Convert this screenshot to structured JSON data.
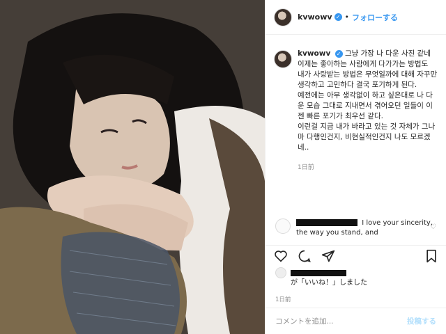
{
  "post": {
    "username": "kvwowv",
    "follow_label": "フォローする",
    "dot": "•",
    "verified_icon": "verified-badge-icon"
  },
  "caption": {
    "username": "kvwowv",
    "lines": [
      "그냥 가장 나 다운 사진 같네",
      "이제는 좋아하는 사람에게 다가가는 방법도",
      "내가 사랑받는 방법은 무엇일까에 대해 자꾸만 생각하고 고민하다 결국 포기하게 된다.",
      "예전에는 아무 생각없이 하고 싶은대로 나 다운 모습 그대로 지내면서 겪어오던 일들이 이젠 빠른 포기가 최우선 같다.",
      "이런걸 지금 내가 바라고 있는 것 자체가 그나마 다행인건지, 비현실적인건지 나도 모르겠네.."
    ],
    "time": "1日前"
  },
  "comment": {
    "text": "I love your sincerity, the way you stand, and"
  },
  "likes": {
    "text": "が「いいね！」しました",
    "days": "1日前"
  },
  "comment_box": {
    "placeholder": "コメントを追加...",
    "post_label": "投稿する"
  },
  "colors": {
    "accent": "#3897f0",
    "post_disabled": "#b2dffc",
    "muted": "#8e8e8e"
  }
}
